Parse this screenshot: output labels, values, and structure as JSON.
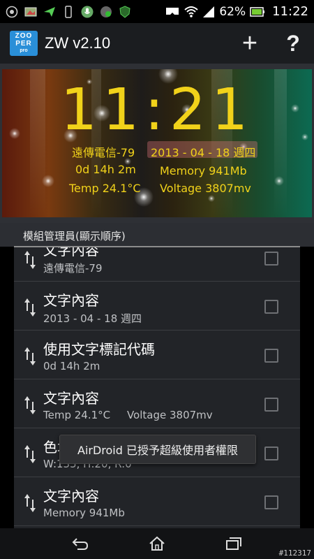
{
  "status_bar": {
    "battery": "62%",
    "time": "11:22",
    "icons": [
      "dashclock-icon",
      "photo-icon",
      "send-icon",
      "phone-icon",
      "mic-icon",
      "speed-icon",
      "android-shield-icon",
      "vr-headset-icon",
      "wifi-icon",
      "signal-icon",
      "battery-icon"
    ]
  },
  "action_bar": {
    "logo_line1": "ZOO",
    "logo_line2": "PER",
    "logo_line3": "pro",
    "title": "ZW v2.10",
    "add_label": "+",
    "help_label": "?"
  },
  "preview": {
    "clock": "11:21",
    "carrier": "遠傳電信-79",
    "date": "2013 - 04 - 18 週四",
    "uptime": "0d 14h 2m",
    "memory": "Memory 941Mb",
    "temp": "Temp 24.1°C",
    "voltage": "Voltage 3807mv",
    "text_color": "#f1d21a"
  },
  "section": {
    "title": "模組管理員(顯示順序)"
  },
  "list": {
    "items": [
      {
        "title": "文字內容",
        "subtitle": "遠傳電信-79"
      },
      {
        "title": "文字內容",
        "subtitle": "2013 - 04 - 18 週四"
      },
      {
        "title": "使用文字標記代碼",
        "subtitle": "0d 14h 2m"
      },
      {
        "title": "文字內容",
        "subtitle": "Temp 24.1°C     Voltage 3807mv"
      },
      {
        "title": "色塊",
        "subtitle": "W:135, H:20, R:0"
      },
      {
        "title": "文字內容",
        "subtitle": "Memory 941Mb"
      }
    ]
  },
  "toast": {
    "message": "AirDroid 已授予超級使用者權限"
  },
  "nav_bar": {
    "icons": [
      "back-icon",
      "home-icon",
      "recent-apps-icon"
    ],
    "watermark": "#112317"
  }
}
